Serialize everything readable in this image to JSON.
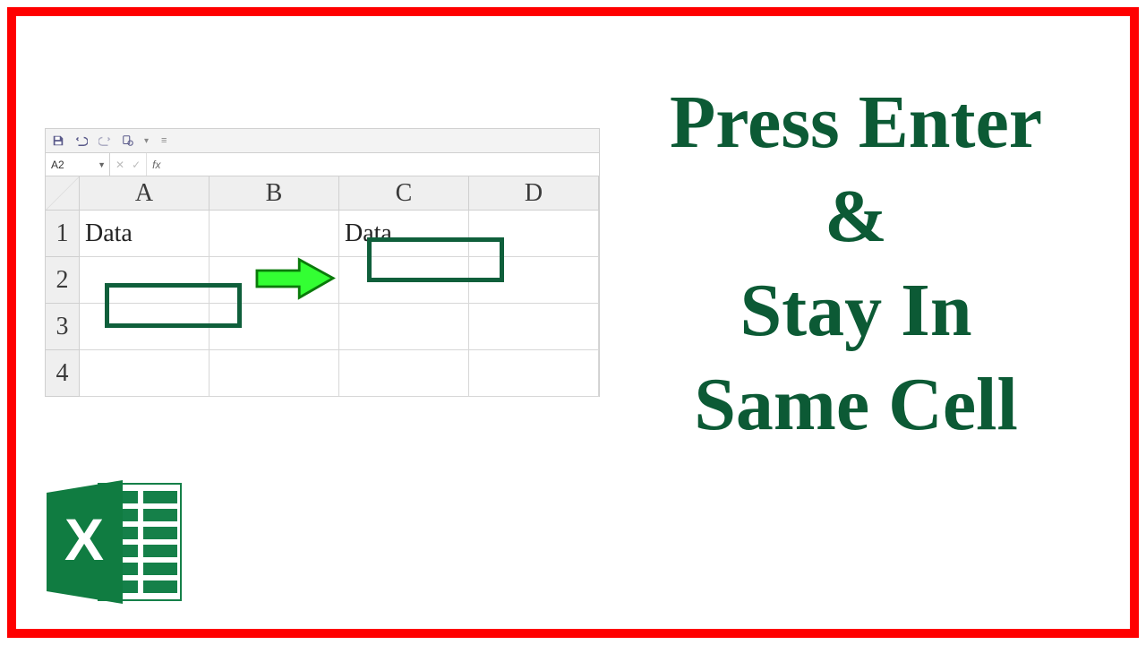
{
  "title": {
    "line1": "Press Enter",
    "line2": "&",
    "line3": "Stay In",
    "line4": "Same Cell"
  },
  "quick_access": {
    "save_icon": "save-icon",
    "undo_icon": "undo-icon",
    "redo_icon": "redo-icon",
    "touch_icon": "touch-icon"
  },
  "formula_bar": {
    "name_box": "A2",
    "fx_label": "fx",
    "value": ""
  },
  "columns": [
    "A",
    "B",
    "C",
    "D"
  ],
  "rows": [
    "1",
    "2",
    "3",
    "4"
  ],
  "cells": {
    "A1": "Data",
    "C1": "Data"
  },
  "logo": {
    "letter": "X"
  },
  "colors": {
    "accent": "#0f5f3b",
    "arrow": "#33ff33",
    "border": "#ff0000"
  }
}
